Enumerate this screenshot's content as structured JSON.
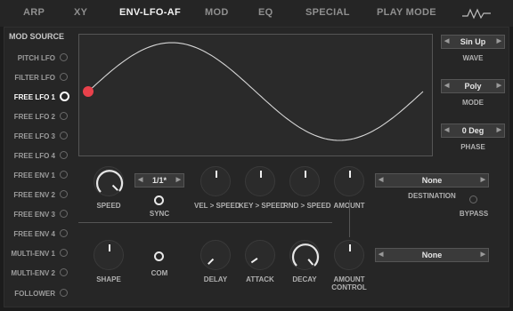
{
  "tabs": [
    "ARP",
    "XY",
    "ENV-LFO-AF",
    "MOD",
    "EQ",
    "SPECIAL",
    "PLAY MODE"
  ],
  "active_tab": "ENV-LFO-AF",
  "mod_source": {
    "title": "MOD SOURCE",
    "items": [
      "PITCH LFO",
      "FILTER LFO",
      "FREE LFO 1",
      "FREE LFO 2",
      "FREE LFO 3",
      "FREE LFO 4",
      "FREE ENV 1",
      "FREE ENV 2",
      "FREE ENV 3",
      "FREE ENV 4",
      "MULTI-ENV 1",
      "MULTI-ENV 2",
      "FOLLOWER"
    ],
    "selected": "FREE LFO 1"
  },
  "right_controls": {
    "wave": {
      "value": "Sin Up",
      "label": "WAVE"
    },
    "mode": {
      "value": "Poly",
      "label": "MODE"
    },
    "phase": {
      "value": "0 Deg",
      "label": "PHASE"
    }
  },
  "controls": {
    "speed_label": "SPEED",
    "sync_value": "1/1*",
    "sync_label": "SYNC",
    "vel_speed": "VEL > SPEED",
    "key_speed": "KEY > SPEED",
    "rnd_speed": "RND > SPEED",
    "amount_label": "AMOUNT",
    "destination_value": "None",
    "destination_label": "DESTINATION",
    "bypass_label": "BYPASS",
    "shape_label": "SHAPE",
    "com_label": "COM",
    "delay_label": "DELAY",
    "attack_label": "ATTACK",
    "decay_label": "DECAY",
    "amount_control_label": "AMOUNT CONTROL",
    "amount_control_value": "None"
  },
  "colors": {
    "accent": "#e8414b",
    "active_text": "#ffffff"
  }
}
